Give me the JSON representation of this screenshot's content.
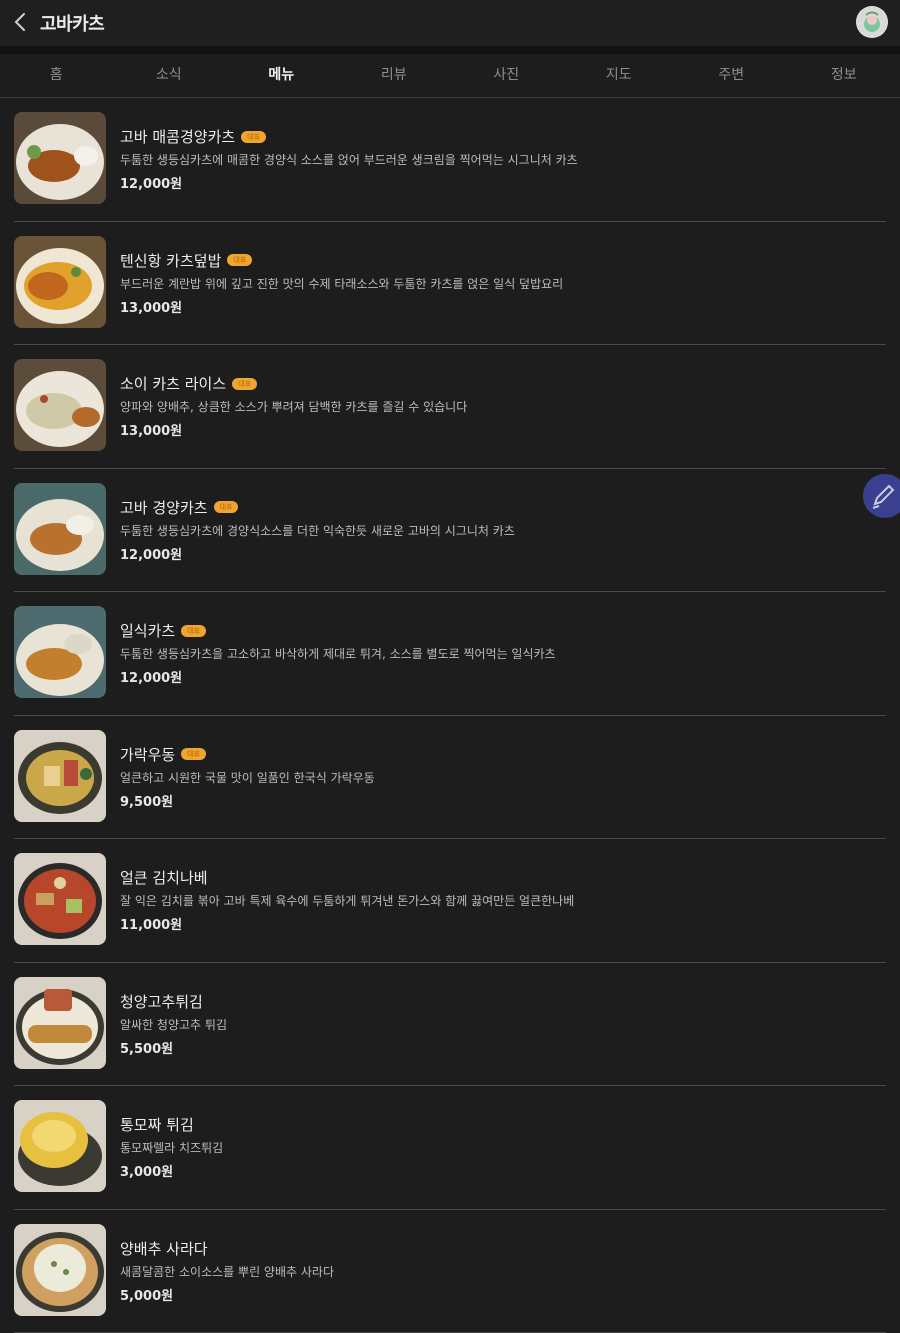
{
  "header": {
    "title": "고바카츠",
    "back_icon": "chevron-left-icon",
    "avatar_icon": "avatar-icon"
  },
  "tabs": [
    {
      "label": "홈"
    },
    {
      "label": "소식"
    },
    {
      "label": "메뉴",
      "active": true
    },
    {
      "label": "리뷰"
    },
    {
      "label": "사진"
    },
    {
      "label": "지도"
    },
    {
      "label": "주변"
    },
    {
      "label": "정보"
    }
  ],
  "colors": {
    "badge": "#f0a530",
    "fab": "#3b3f8f",
    "background": "#1d1d1d"
  },
  "menu": [
    {
      "name": "고바 매콤경양카츠",
      "badge": "대표",
      "desc": "두툼한 생등심카츠에 매콤한 경양식 소스를 얹어 부드러운 생크림을 찍어먹는 시그니처 카츠",
      "price": "12,000원"
    },
    {
      "name": "텐신항 카츠덮밥",
      "badge": "대표",
      "desc": "부드러운 계란밥 위에 깊고 진한 맛의 수제 타래소스와 두툼한 카츠를 얹은 일식 덮밥요리",
      "price": "13,000원"
    },
    {
      "name": "소이 카츠 라이스",
      "badge": "대표",
      "desc": "양파와 양배추, 상큼한 소스가 뿌려져 담백한 카츠를 즐길 수 있습니다",
      "price": "13,000원"
    },
    {
      "name": "고바 경양카츠",
      "badge": "대표",
      "desc": "두툼한 생등심카츠에 경양식소스를 더한 익숙한듯 새로운 고바의 시그니처 카츠",
      "price": "12,000원"
    },
    {
      "name": "일식카츠",
      "badge": "대표",
      "desc": "두툼한 생등심카츠을 고소하고 바삭하게 제대로 튀겨, 소스를 별도로 찍어먹는 일식카츠",
      "price": "12,000원"
    },
    {
      "name": "가락우동",
      "badge": "대표",
      "desc": "얼큰하고 시원한 국물 맛이 일품인 한국식 가락우동",
      "price": "9,500원"
    },
    {
      "name": "얼큰 김치나베",
      "badge": "",
      "desc": "잘 익은 김치를 볶아 고바 특제 육수에 두툼하게 튀겨낸 돈가스와 함께 끓여만든 얼큰한나베",
      "price": "11,000원"
    },
    {
      "name": "청양고추튀김",
      "badge": "",
      "desc": "알싸한 청양고추 튀김",
      "price": "5,500원"
    },
    {
      "name": "통모짜 튀김",
      "badge": "",
      "desc": "통모짜렐라 치즈튀김",
      "price": "3,000원"
    },
    {
      "name": "양배추 사라다",
      "badge": "",
      "desc": "새콤달콤한 소이소스를 뿌린 양배추 사라다",
      "price": "5,000원"
    }
  ],
  "fab": {
    "icon": "pencil-icon"
  }
}
